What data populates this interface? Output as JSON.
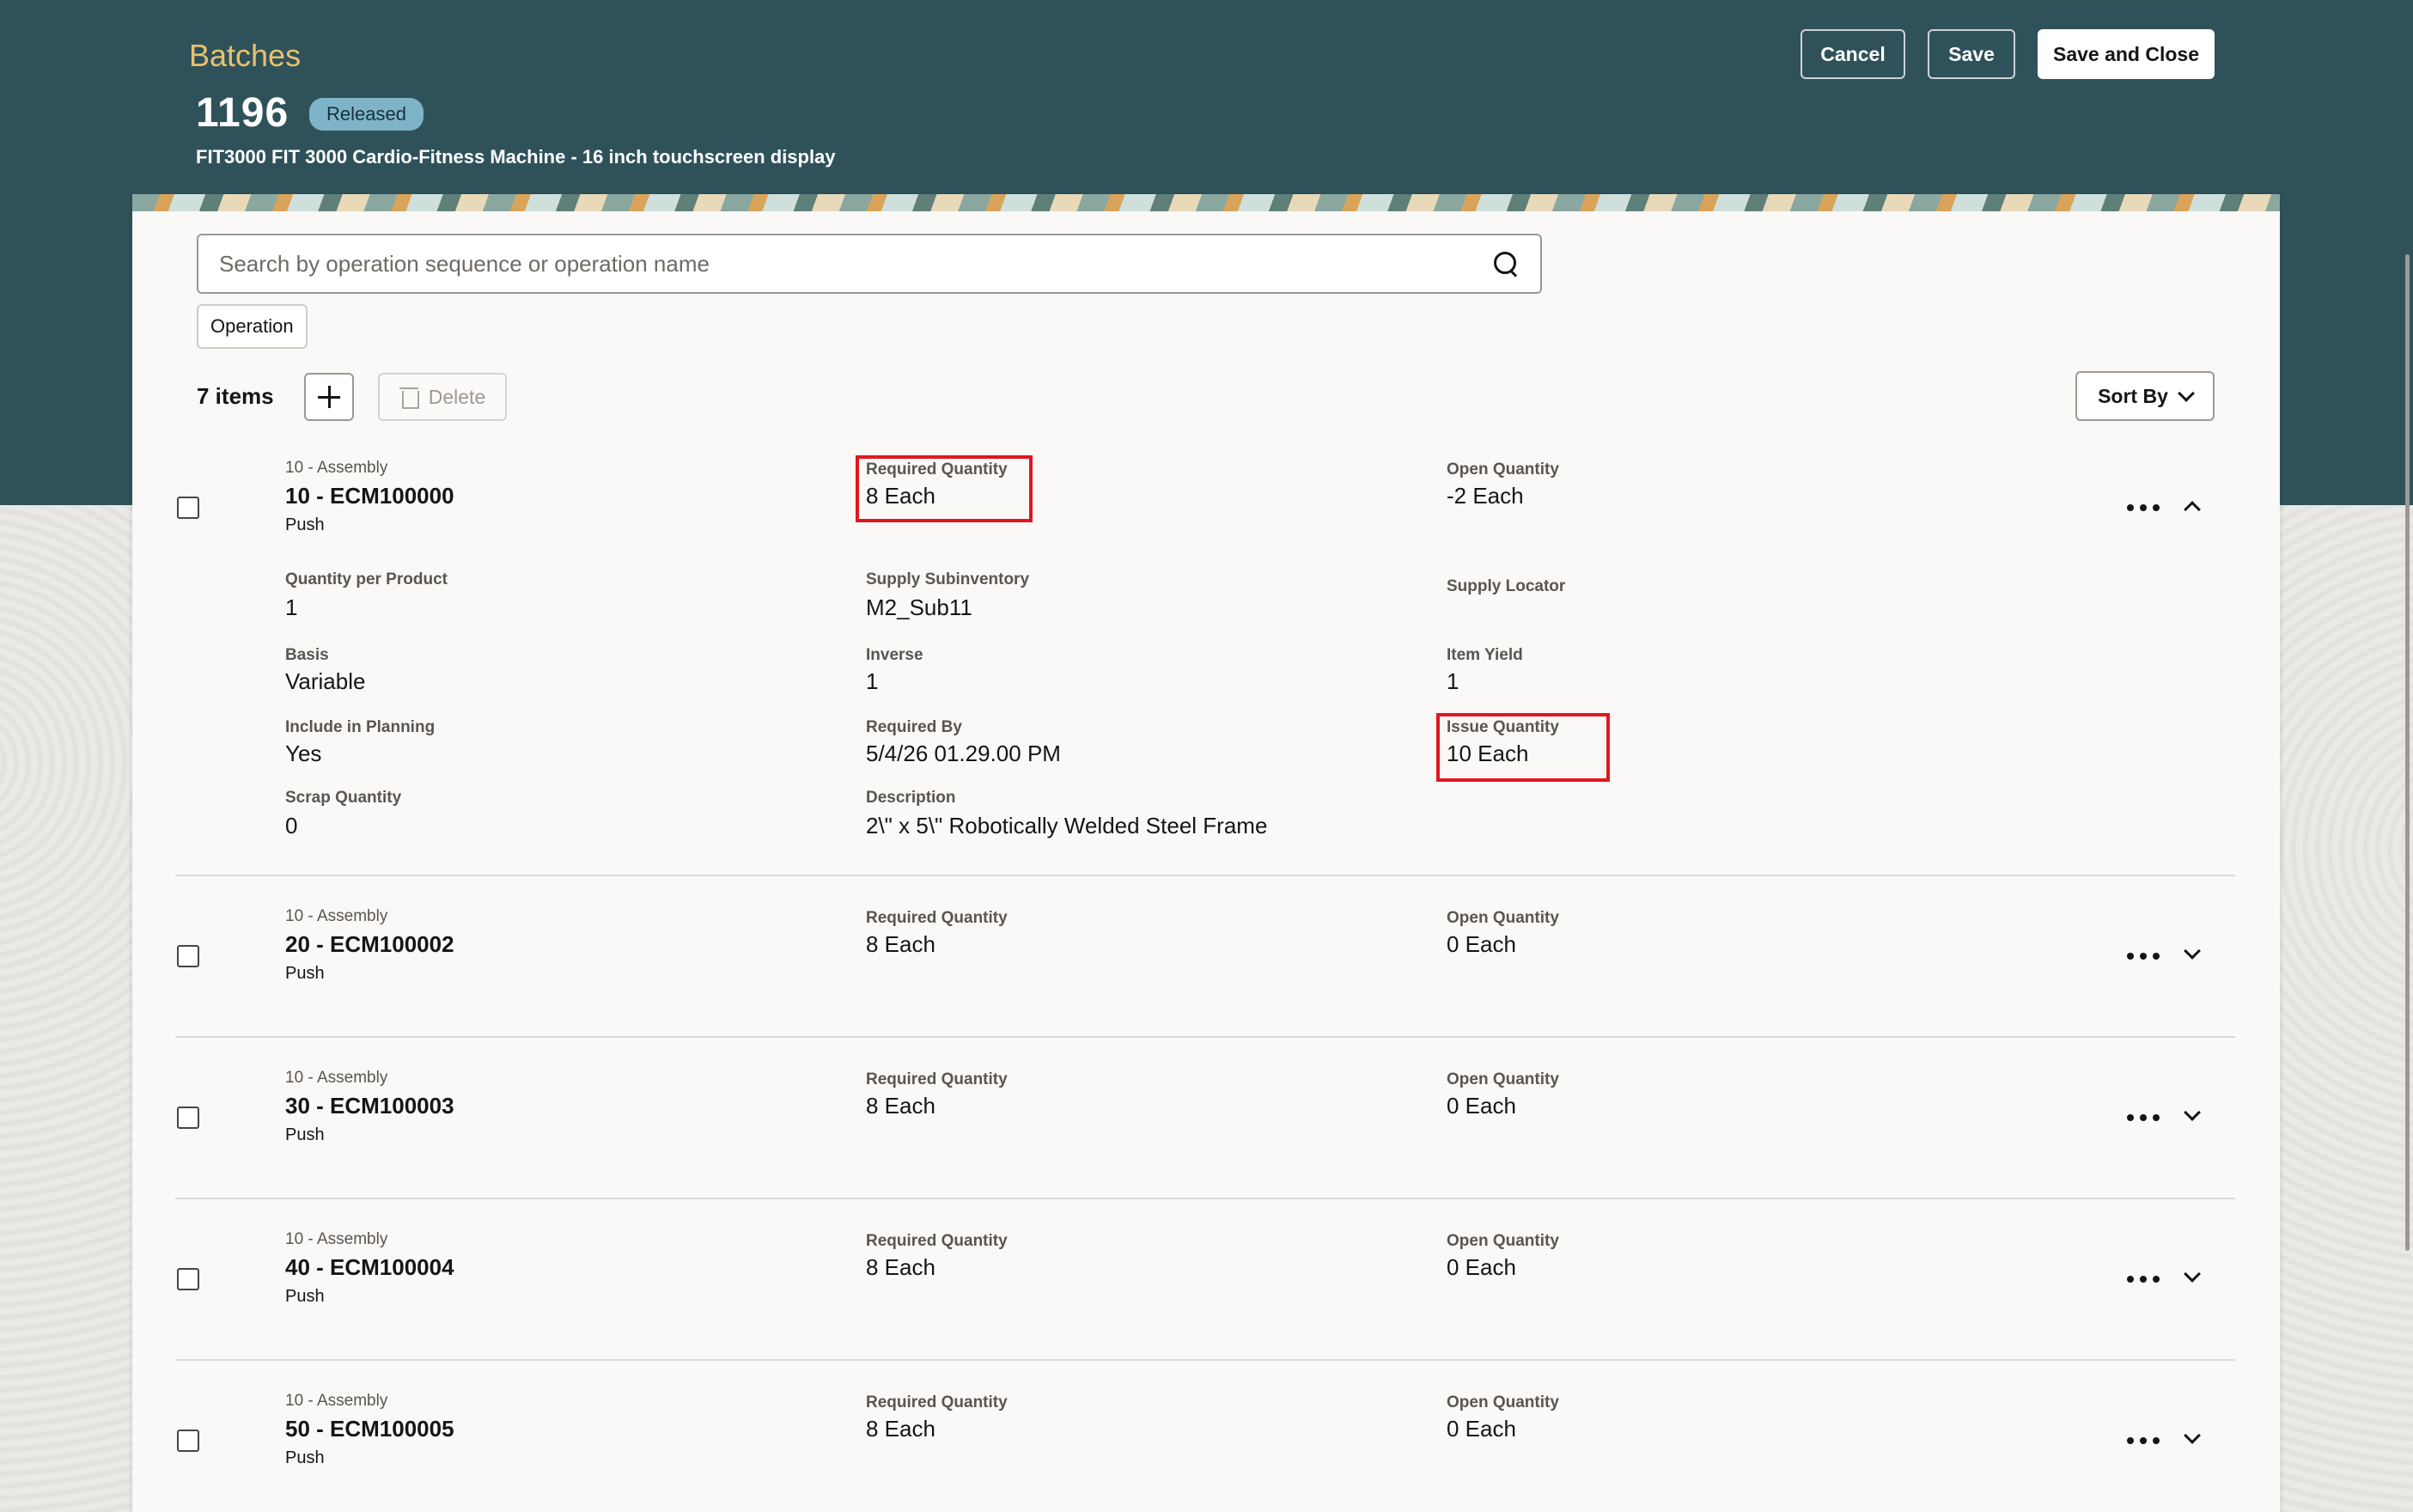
{
  "header": {
    "breadcrumb": "Batches",
    "batch_number": "1196",
    "status": "Released",
    "subtitle": "FIT3000 FIT 3000 Cardio-Fitness Machine - 16 inch touchscreen display",
    "cancel_label": "Cancel",
    "save_label": "Save",
    "save_close_label": "Save and Close"
  },
  "search": {
    "placeholder": "Search by operation sequence or operation name"
  },
  "filter_chip": "Operation",
  "toolbar": {
    "items_count": "7 items",
    "delete_label": "Delete",
    "sort_label": "Sort By"
  },
  "labels": {
    "required_quantity": "Required Quantity",
    "open_quantity": "Open Quantity",
    "quantity_per_product": "Quantity per Product",
    "supply_subinventory": "Supply Subinventory",
    "supply_locator": "Supply Locator",
    "basis": "Basis",
    "inverse": "Inverse",
    "item_yield": "Item Yield",
    "include_in_planning": "Include in Planning",
    "required_by": "Required By",
    "issue_quantity": "Issue Quantity",
    "scrap_quantity": "Scrap Quantity",
    "description": "Description"
  },
  "rows": [
    {
      "operation": "10 - Assembly",
      "title": "10 - ECM100000",
      "supply_type": "Push",
      "required_quantity": "8 Each",
      "open_quantity": "-2 Each",
      "expanded": true,
      "details": {
        "quantity_per_product": "1",
        "supply_subinventory": "M2_Sub11",
        "supply_locator": "",
        "basis": "Variable",
        "inverse": "1",
        "item_yield": "1",
        "include_in_planning": "Yes",
        "required_by": "5/4/26 01.29.00 PM",
        "issue_quantity": "10 Each",
        "scrap_quantity": "0",
        "description": "2\\\" x 5\\\" Robotically Welded Steel Frame"
      }
    },
    {
      "operation": "10 - Assembly",
      "title": "20 - ECM100002",
      "supply_type": "Push",
      "required_quantity": "8 Each",
      "open_quantity": "0 Each",
      "expanded": false
    },
    {
      "operation": "10 - Assembly",
      "title": "30 - ECM100003",
      "supply_type": "Push",
      "required_quantity": "8 Each",
      "open_quantity": "0 Each",
      "expanded": false
    },
    {
      "operation": "10 - Assembly",
      "title": "40 - ECM100004",
      "supply_type": "Push",
      "required_quantity": "8 Each",
      "open_quantity": "0 Each",
      "expanded": false
    },
    {
      "operation": "10 - Assembly",
      "title": "50 - ECM100005",
      "supply_type": "Push",
      "required_quantity": "8 Each",
      "open_quantity": "0 Each",
      "expanded": false
    }
  ],
  "colors": {
    "header_bg": "#2f525a",
    "breadcrumb": "#e9c16e",
    "status_badge": "#7fb4c8",
    "highlight": "#e2171e"
  }
}
